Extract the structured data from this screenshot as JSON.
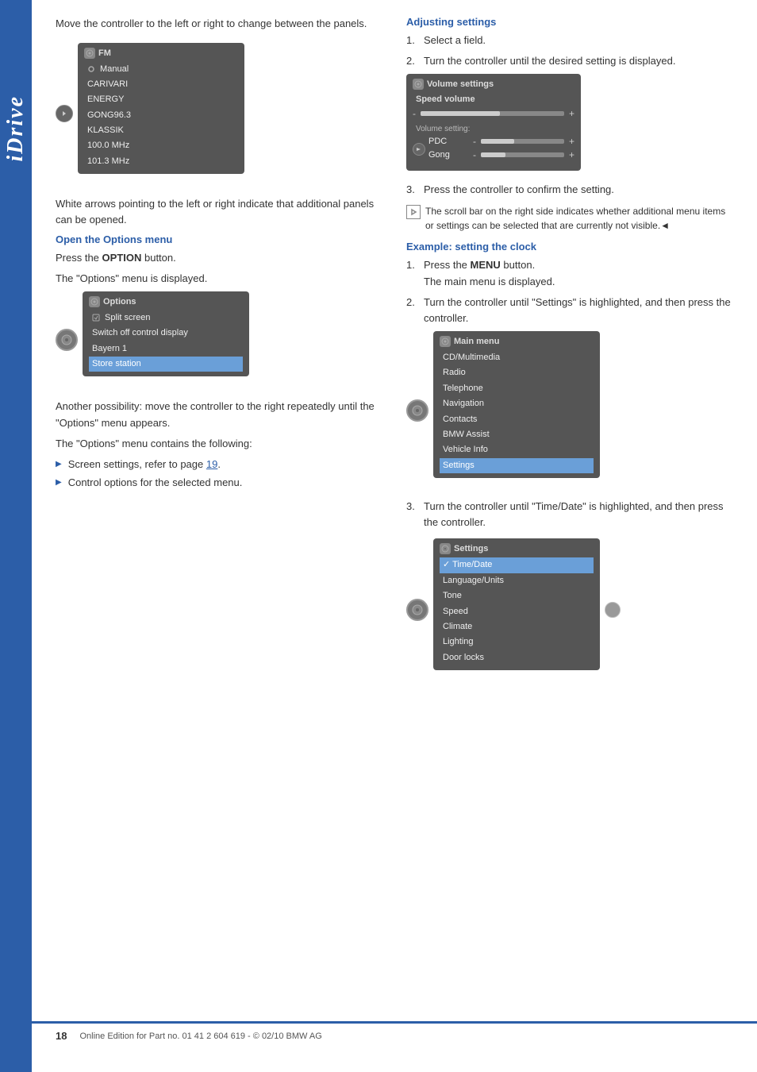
{
  "sidebar": {
    "label": "iDrive"
  },
  "left_col": {
    "intro_text": "Move the controller to the left or right to change between the panels.",
    "fm_screen": {
      "title": "FM",
      "items": [
        {
          "text": "Manual",
          "icon": true
        },
        {
          "text": "CARIVARI"
        },
        {
          "text": "ENERGY"
        },
        {
          "text": "GONG96.3"
        },
        {
          "text": "KLASSIK"
        },
        {
          "text": "100.0  MHz"
        },
        {
          "text": "101.3  MHz"
        }
      ]
    },
    "white_arrows_text": "White arrows pointing to the left or right indicate that additional panels can be opened.",
    "options_section": {
      "heading": "Open the Options menu",
      "body1": "Press the OPTION button.",
      "body2": "The \"Options\" menu is displayed.",
      "screen": {
        "title": "Options",
        "items": [
          {
            "text": "Split screen",
            "icon": true
          },
          {
            "text": "Switch off control display"
          },
          {
            "text": "Bayern 1"
          },
          {
            "text": "Store station",
            "highlighted": true
          }
        ]
      },
      "body3": "Another possibility: move the controller to the right repeatedly until the \"Options\" menu appears.",
      "body4": "The \"Options\" menu contains the following:",
      "bullets": [
        {
          "text": "Screen settings, refer to page 19."
        },
        {
          "text": "Control options for the selected menu."
        }
      ]
    }
  },
  "right_col": {
    "adjusting_section": {
      "heading": "Adjusting settings",
      "steps": [
        {
          "num": "1.",
          "text": "Select a field."
        },
        {
          "num": "2.",
          "text": "Turn the controller until the desired setting is displayed."
        }
      ],
      "vol_screen": {
        "title": "Volume settings",
        "speed_vol": "Speed volume",
        "vol_setting": "Volume setting:",
        "items": [
          {
            "label": "PDC",
            "fill": 40
          },
          {
            "label": "Gong",
            "fill": 30
          }
        ]
      },
      "step3": {
        "num": "3.",
        "text": "Press the controller to confirm the setting."
      },
      "note": "The scroll bar on the right side indicates whether additional menu items or settings can be selected that are currently not visible.◄"
    },
    "clock_section": {
      "heading": "Example: setting the clock",
      "steps": [
        {
          "num": "1.",
          "text": "Press the MENU button.\nThe main menu is displayed."
        },
        {
          "num": "2.",
          "text": "Turn the controller until \"Settings\" is highlighted, and then press the controller."
        }
      ],
      "main_menu_screen": {
        "title": "Main menu",
        "items": [
          {
            "text": "CD/Multimedia"
          },
          {
            "text": "Radio"
          },
          {
            "text": "Telephone"
          },
          {
            "text": "Navigation"
          },
          {
            "text": "Contacts"
          },
          {
            "text": "BMW Assist"
          },
          {
            "text": "Vehicle Info"
          },
          {
            "text": "Settings",
            "highlighted": true
          }
        ]
      },
      "step3": {
        "num": "3.",
        "text": "Turn the controller until \"Time/Date\" is highlighted, and then press the controller."
      },
      "settings_screen": {
        "title": "Settings",
        "items": [
          {
            "text": "✓  Time/Date",
            "highlighted": true
          },
          {
            "text": "Language/Units"
          },
          {
            "text": "Tone"
          },
          {
            "text": "Speed"
          },
          {
            "text": "Climate"
          },
          {
            "text": "Lighting"
          },
          {
            "text": "Door locks"
          }
        ]
      }
    }
  },
  "footer": {
    "page_number": "18",
    "text": "Online Edition for Part no. 01 41 2 604 619 - © 02/10 BMW AG"
  }
}
